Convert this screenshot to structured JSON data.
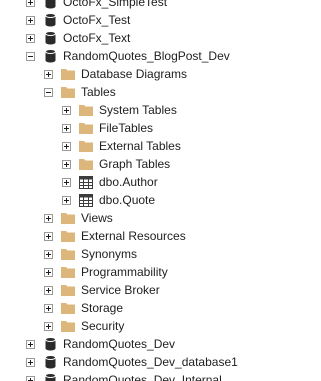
{
  "tree": {
    "items": [
      {
        "label": "OctoFx_SimpleTest",
        "expander": "plus",
        "icon": "database-icon"
      },
      {
        "label": "OctoFx_Test",
        "expander": "plus",
        "icon": "database-icon"
      },
      {
        "label": "OctoFx_Text",
        "expander": "plus",
        "icon": "database-icon"
      },
      {
        "label": "RandomQuotes_BlogPost_Dev",
        "expander": "minus",
        "icon": "database-icon"
      },
      {
        "label": "Database Diagrams",
        "expander": "plus",
        "icon": "folder-icon"
      },
      {
        "label": "Tables",
        "expander": "minus",
        "icon": "folder-icon"
      },
      {
        "label": "System Tables",
        "expander": "plus",
        "icon": "folder-icon"
      },
      {
        "label": "FileTables",
        "expander": "plus",
        "icon": "folder-icon"
      },
      {
        "label": "External Tables",
        "expander": "plus",
        "icon": "folder-icon"
      },
      {
        "label": "Graph Tables",
        "expander": "plus",
        "icon": "folder-icon"
      },
      {
        "label": "dbo.Author",
        "expander": "plus",
        "icon": "table-icon"
      },
      {
        "label": "dbo.Quote",
        "expander": "plus",
        "icon": "table-icon"
      },
      {
        "label": "Views",
        "expander": "plus",
        "icon": "folder-icon"
      },
      {
        "label": "External Resources",
        "expander": "plus",
        "icon": "folder-icon"
      },
      {
        "label": "Synonyms",
        "expander": "plus",
        "icon": "folder-icon"
      },
      {
        "label": "Programmability",
        "expander": "plus",
        "icon": "folder-icon"
      },
      {
        "label": "Service Broker",
        "expander": "plus",
        "icon": "folder-icon"
      },
      {
        "label": "Storage",
        "expander": "plus",
        "icon": "folder-icon"
      },
      {
        "label": "Security",
        "expander": "plus",
        "icon": "folder-icon"
      },
      {
        "label": "RandomQuotes_Dev",
        "expander": "plus",
        "icon": "database-icon"
      },
      {
        "label": "RandomQuotes_Dev_database1",
        "expander": "plus",
        "icon": "database-icon"
      },
      {
        "label": "RandomQuotes_Dev_Internal",
        "expander": "plus",
        "icon": "database-icon"
      }
    ]
  },
  "colors": {
    "folder": "#dcb67a",
    "database": "#2b2b2b",
    "table_grid": "#3c3c3c",
    "expander_border": "#9a9a9a"
  }
}
